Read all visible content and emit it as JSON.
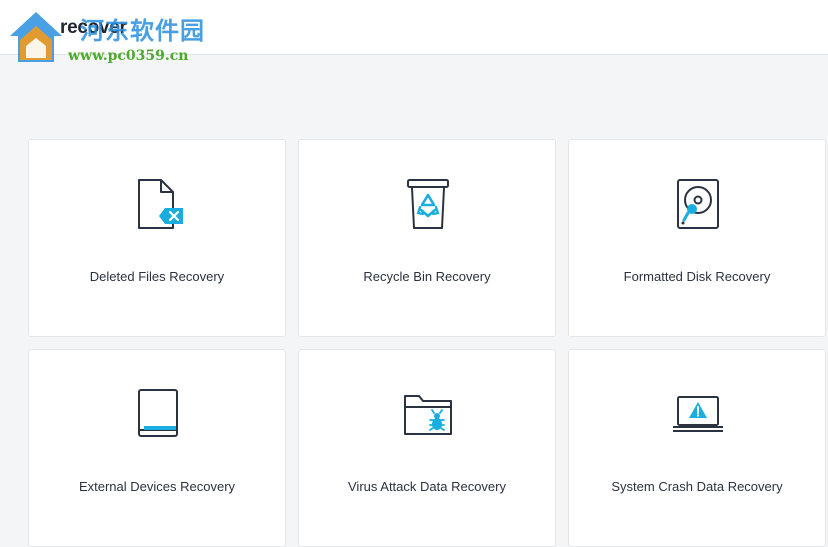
{
  "app": {
    "name": "recover",
    "watermark_cn": "河东软件园",
    "watermark_url": "www.pc0359.cn"
  },
  "colors": {
    "accent": "#1aaee0",
    "icon_stroke": "#2b3240",
    "background": "#f4f5f7",
    "card": "#ffffff"
  },
  "modes": [
    {
      "label": "Deleted Files Recovery",
      "icon": "deleted-file-icon"
    },
    {
      "label": "Recycle Bin Recovery",
      "icon": "recycle-bin-icon"
    },
    {
      "label": "Formatted Disk Recovery",
      "icon": "hard-disk-icon"
    },
    {
      "label": "External Devices Recovery",
      "icon": "external-device-icon"
    },
    {
      "label": "Virus Attack Data Recovery",
      "icon": "virus-folder-icon"
    },
    {
      "label": "System Crash Data Recovery",
      "icon": "system-crash-icon"
    }
  ]
}
